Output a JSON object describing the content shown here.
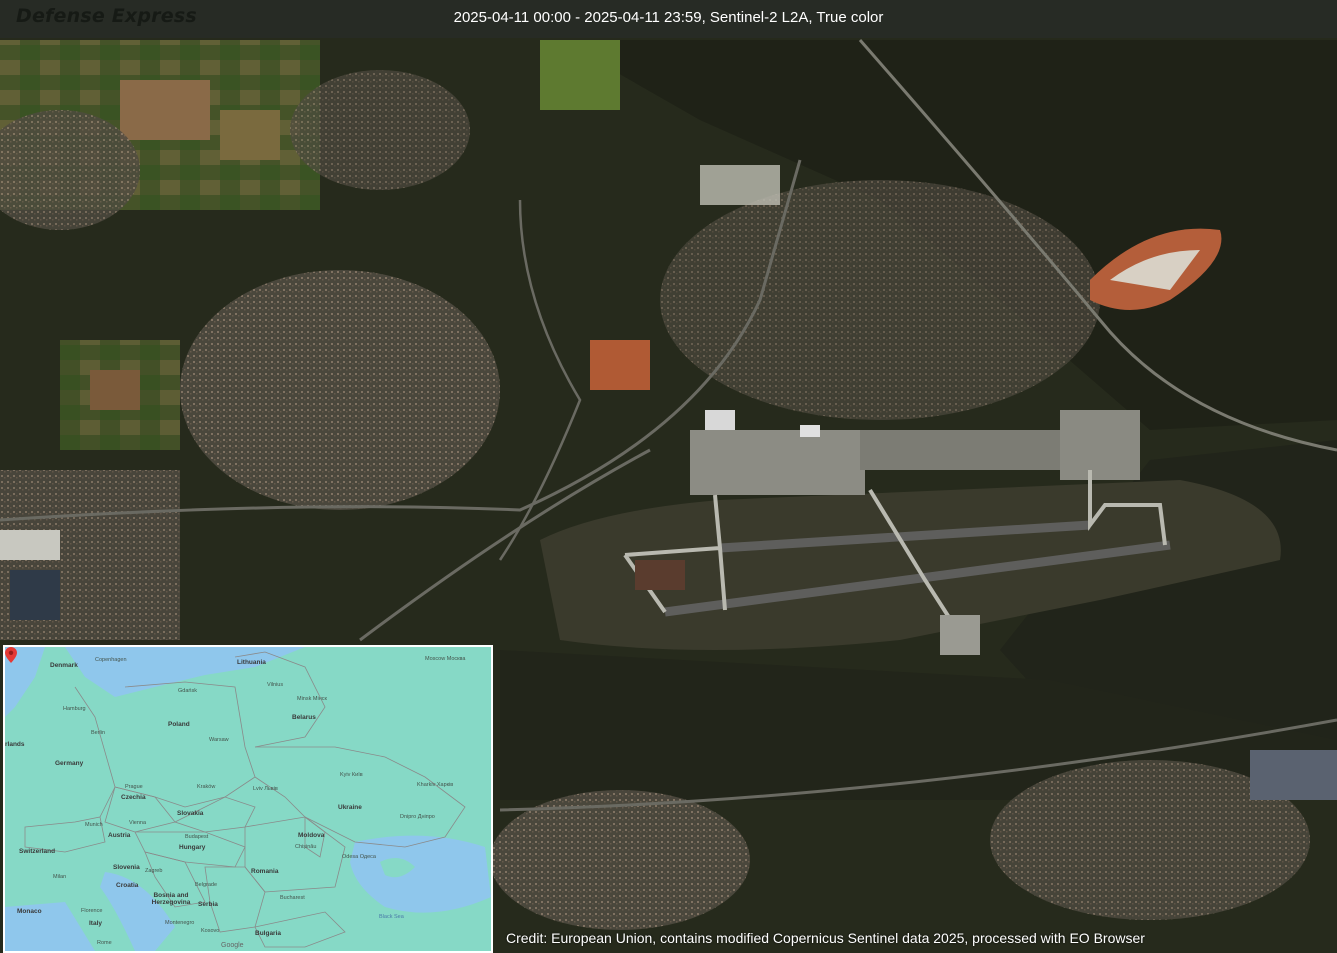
{
  "header": {
    "watermark": "Defense Express",
    "title": "2025-04-11 00:00 - 2025-04-11 23:59, Sentinel-2 L2A, True color"
  },
  "footer": {
    "credit": "Credit: European Union, contains modified Copernicus Sentinel data 2025, processed with EO Browser"
  },
  "inset_map": {
    "pin_icon": "map-pin-icon",
    "pin_color": "#e53935",
    "labels": {
      "denmark": "Denmark",
      "copenhagen": "Copenhagen",
      "lithuania": "Lithuania",
      "moscow": "Moscow Москва",
      "gdansk": "Gdańsk",
      "vilnius": "Vilnius",
      "hamburg": "Hamburg",
      "minsk": "Minsk Мінск",
      "berlin": "Berlin",
      "poland": "Poland",
      "belarus": "Belarus",
      "warsaw": "Warsaw",
      "netherlands": "rlands",
      "germany": "Germany",
      "kyiv": "Kyiv Київ",
      "kharkiv": "Kharkiv Харків",
      "lviv": "Lviv Львів",
      "krakow": "Kraków",
      "prague": "Prague",
      "czechia": "Czechia",
      "ukraine": "Ukraine",
      "slovakia": "Slovakia",
      "munich": "Munich",
      "vienna": "Vienna",
      "dnipro": "Dnipro Дніпро",
      "austria": "Austria",
      "budapest": "Budapest",
      "moldova": "Moldova",
      "switzerland": "Switzerland",
      "hungary": "Hungary",
      "chisinau": "Chișinău",
      "odesa": "Odesa Одеса",
      "milan": "Milan",
      "zagreb": "Zagreb",
      "slovenia": "Slovenia",
      "romania": "Romania",
      "croatia": "Croatia",
      "belgrade": "Belgrade",
      "bucharest": "Bucharest",
      "bosnia": "Bosnia and Herzegovina",
      "serbia": "Serbia",
      "monaco": "Monaco",
      "florence": "Florence",
      "black_sea": "Black Sea",
      "montenegro": "Montenegro",
      "kosovo": "Kosovo",
      "italy": "Italy",
      "bulgaria": "Bulgaria",
      "rome": "Rome",
      "google": "Google"
    }
  }
}
